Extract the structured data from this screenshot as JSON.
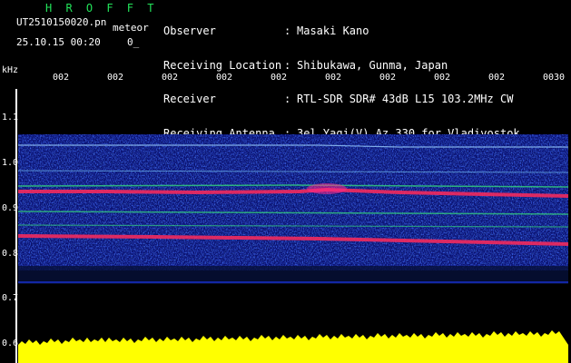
{
  "header": {
    "app_title": "H R O F F T",
    "file_name": "UT2510150020.pn",
    "meteor_label": "meteor",
    "date_time": "25.10.15 00:20",
    "date_time_extra": "0_",
    "rows": [
      {
        "label": "Observer",
        "colon": ":",
        "value": "Masaki Kano"
      },
      {
        "label": "Receiving Location",
        "colon": ":",
        "value": "Shibukawa, Gunma, Japan"
      },
      {
        "label": "Receiver",
        "colon": ":",
        "value": "RTL-SDR SDR# 43dB L15 103.2MHz CW"
      },
      {
        "label": "Receiving Antenna",
        "colon": ":",
        "value": "3el Yagi(V) Az 330 for Vladivostok"
      }
    ]
  },
  "axes": {
    "y_unit": "kHz",
    "y_ticks": [
      "1.1",
      "1.0",
      "0.9",
      "0.8",
      "0.7",
      "0.6"
    ],
    "x_ticks": [
      "002",
      "002",
      "002",
      "002",
      "002",
      "002",
      "002",
      "002",
      "002",
      "0030"
    ]
  },
  "colors": {
    "background": "#000000",
    "title_green": "#22e35a",
    "text": "#ffffff",
    "noise_blue": "#1a2bd8",
    "signal_red": "#ff2a5a",
    "signal_green": "#36e07a",
    "amplitude_yellow": "#ffff00"
  }
}
